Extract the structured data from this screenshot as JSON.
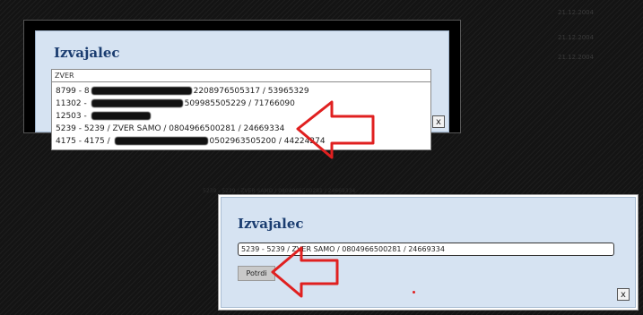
{
  "background_dates": [
    "21.12.2004",
    "21.12.2004",
    "21.12.2004"
  ],
  "background_text": "5239 - 5239 / ZVER SAMO / 0804966500281 / 24669334",
  "dialog_top": {
    "title": "Izvajalec",
    "search_value": "ZVER",
    "close_label": "x",
    "items": [
      {
        "prefix": "8799 - 8",
        "suffix": "2208976505317 / 53965329"
      },
      {
        "prefix": "11302 - ",
        "suffix": "509985505229 / 71766090"
      },
      {
        "prefix": "12503 - ",
        "suffix": ""
      },
      {
        "prefix": "5239 - 5239 / ZVER SAMO / 0804966500281 / 24669334",
        "suffix": ""
      },
      {
        "prefix": "4175 - 4175 / ",
        "suffix": "0502963505200 / 44224274"
      }
    ]
  },
  "dialog_bottom": {
    "title": "Izvajalec",
    "field_value": "5239 - 5239 / ZVER SAMO / 0804966500281 / 24669334",
    "confirm_label": "Potrdi",
    "close_label": "x"
  },
  "colors": {
    "dialog_bg": "#d6e3f2",
    "title": "#1b3d70",
    "arrow": "#e02020"
  }
}
